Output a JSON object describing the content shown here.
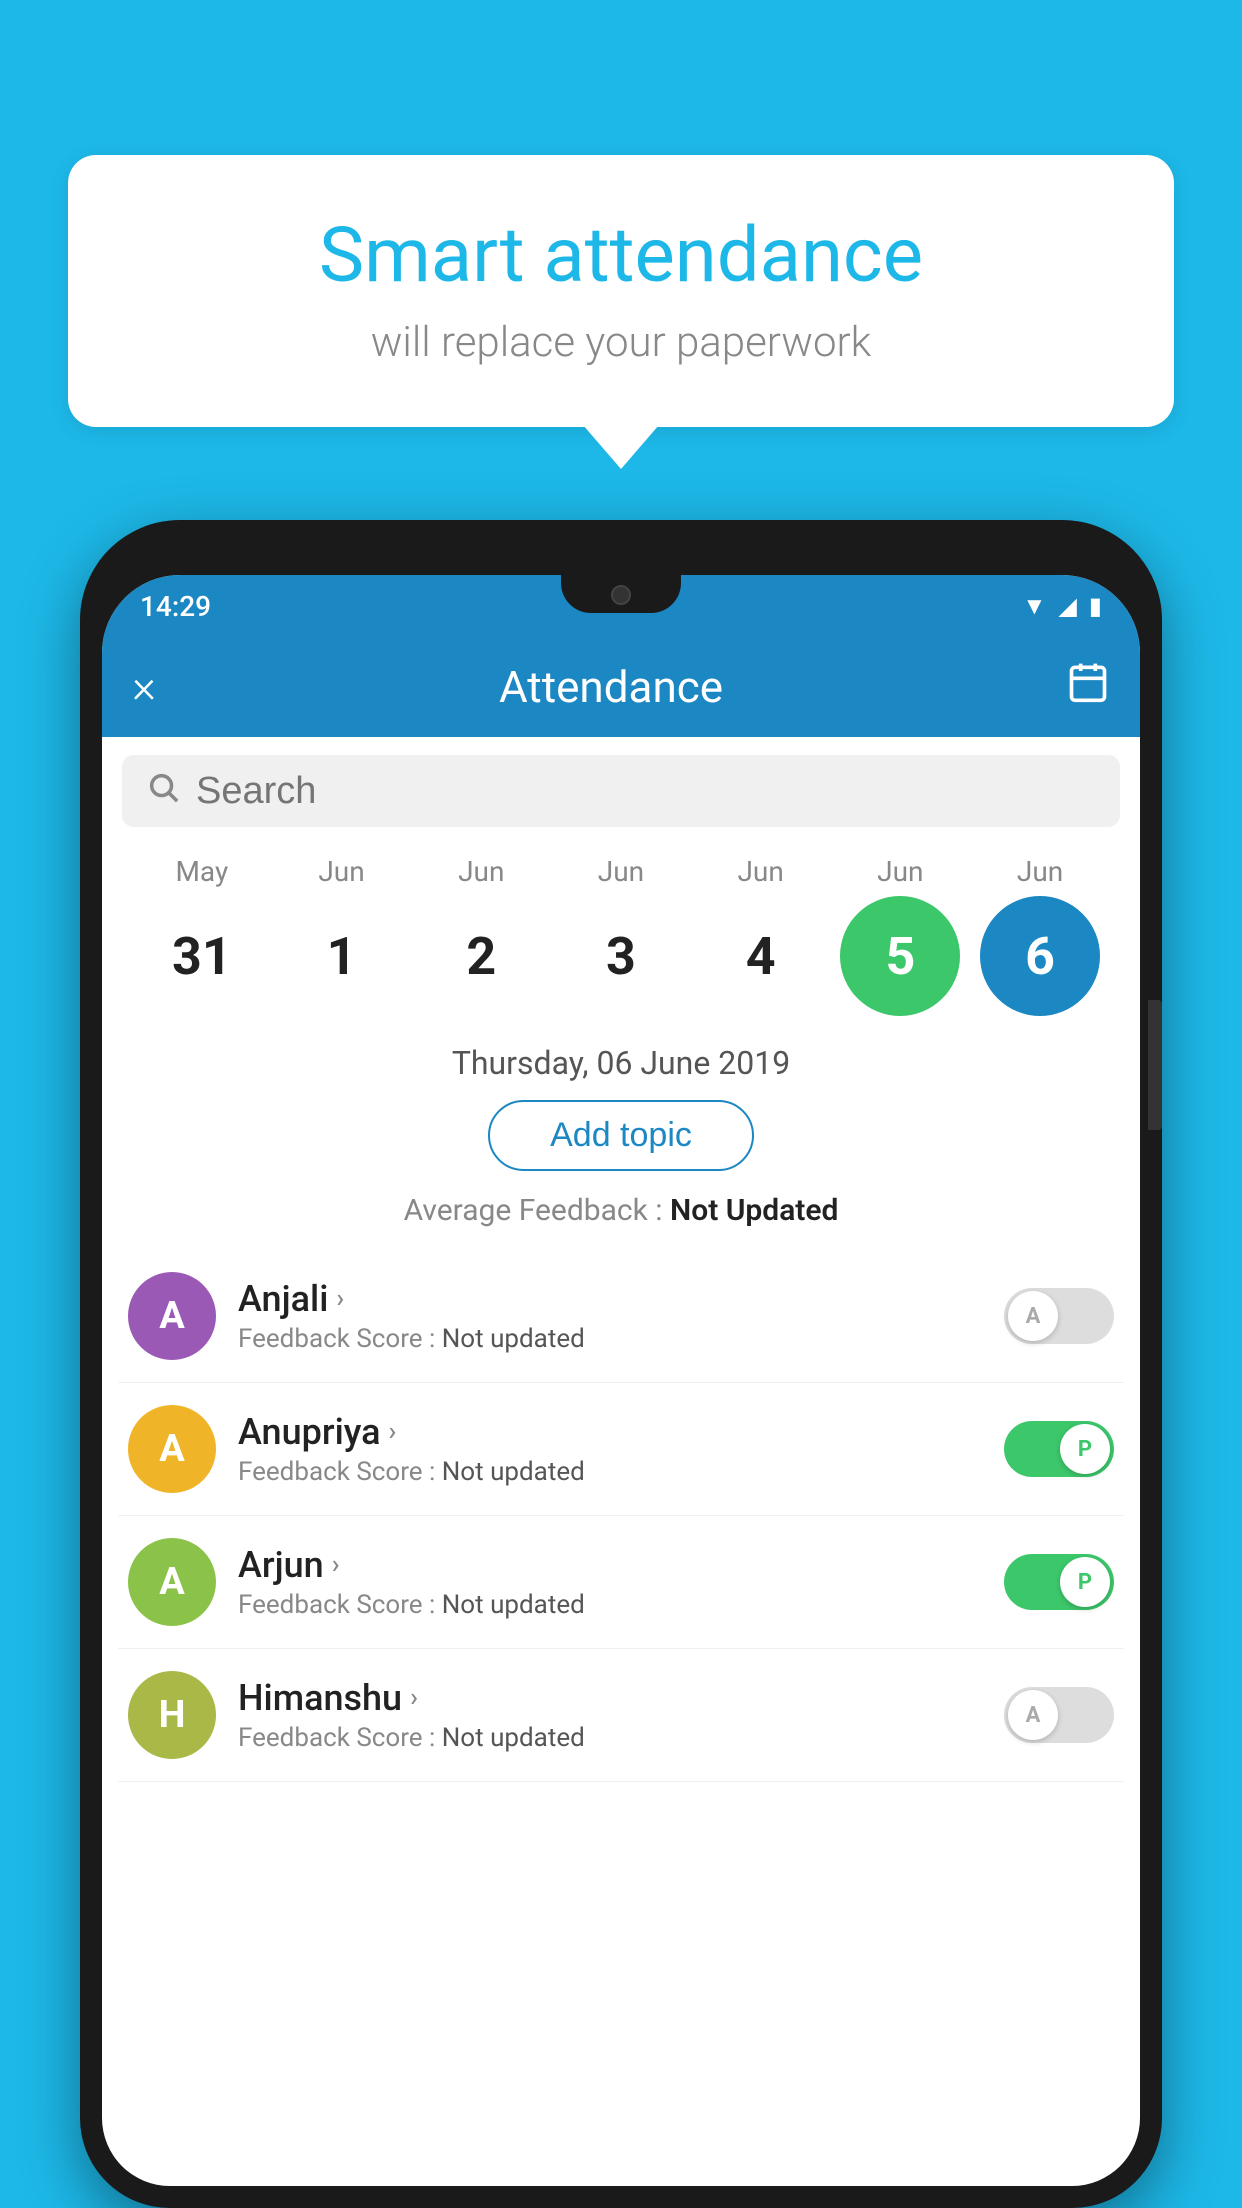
{
  "background_color": "#1db8e8",
  "bubble": {
    "title": "Smart attendance",
    "subtitle": "will replace your paperwork"
  },
  "status_bar": {
    "time": "14:29",
    "icons": [
      "wifi",
      "signal",
      "battery"
    ]
  },
  "app_bar": {
    "title": "Attendance",
    "close_label": "×",
    "calendar_icon": "📅"
  },
  "search": {
    "placeholder": "Search"
  },
  "calendar": {
    "months": [
      "May",
      "Jun",
      "Jun",
      "Jun",
      "Jun",
      "Jun",
      "Jun"
    ],
    "dates": [
      "31",
      "1",
      "2",
      "3",
      "4",
      "5",
      "6"
    ],
    "selected_index": 6,
    "today_index": 5,
    "selected_date_label": "Thursday, 06 June 2019"
  },
  "add_topic_button": "Add topic",
  "avg_feedback": {
    "label": "Average Feedback : ",
    "value": "Not Updated"
  },
  "students": [
    {
      "name": "Anjali",
      "avatar_letter": "A",
      "avatar_color": "#9b59b6",
      "feedback_label": "Feedback Score : ",
      "feedback_value": "Not updated",
      "toggle_state": "off",
      "toggle_label": "A"
    },
    {
      "name": "Anupriya",
      "avatar_letter": "A",
      "avatar_color": "#f0b429",
      "feedback_label": "Feedback Score : ",
      "feedback_value": "Not updated",
      "toggle_state": "on",
      "toggle_label": "P"
    },
    {
      "name": "Arjun",
      "avatar_letter": "A",
      "avatar_color": "#8bc34a",
      "feedback_label": "Feedback Score : ",
      "feedback_value": "Not updated",
      "toggle_state": "on",
      "toggle_label": "P"
    },
    {
      "name": "Himanshu",
      "avatar_letter": "H",
      "avatar_color": "#aab847",
      "feedback_label": "Feedback Score : ",
      "feedback_value": "Not updated",
      "toggle_state": "off",
      "toggle_label": "A"
    }
  ]
}
